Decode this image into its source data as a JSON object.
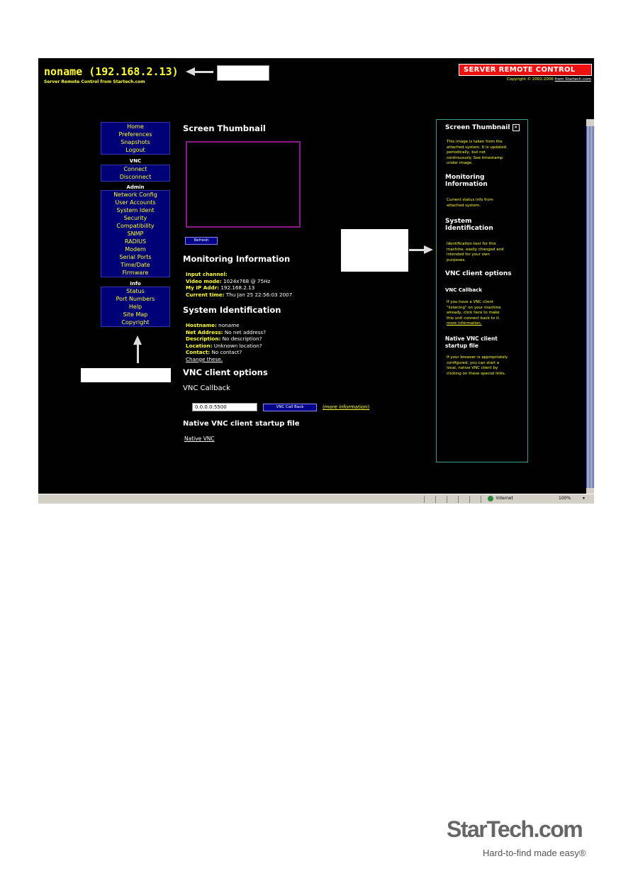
{
  "header": {
    "title": "noname (192.168.2.13)",
    "subtitle": "Server Remote Control from Startech.com",
    "logo": "SERVER REMOTE CONTROL",
    "copyright": "Copyright © 2002-2006",
    "copyright_link": "from Startech.com"
  },
  "nav": {
    "group1": [
      "Home",
      "Preferences",
      "Snapshots",
      "Logout"
    ],
    "vnc_header": "VNC",
    "group2": [
      "Connect",
      "Disconnect"
    ],
    "admin_header": "Admin",
    "group3": [
      "Network Config",
      "User Accounts",
      "System Ident",
      "Security",
      "Compatibility",
      "SNMP",
      "RADIUS",
      "Modem",
      "Serial Ports",
      "Time/Date",
      "Firmware"
    ],
    "info_header": "Info",
    "group4": [
      "Status",
      "Port Numbers",
      "Help",
      "Site Map",
      "Copyright"
    ]
  },
  "main": {
    "thumb_heading": "Screen Thumbnail",
    "refresh_label": "Refresh",
    "monitor_heading": "Monitoring Information",
    "monitor": [
      {
        "label": "Input channel:",
        "value": ""
      },
      {
        "label": "Video mode:",
        "value": "1024x768 @ 75Hz"
      },
      {
        "label": "My IP Addr:",
        "value": "192.168.2.13"
      },
      {
        "label": "Current time:",
        "value": "Thu Jan 25 22:56:03 2007"
      }
    ],
    "sysid_heading": "System Identification",
    "sysid": [
      {
        "label": "Hostname:",
        "value": "noname"
      },
      {
        "label": "Net Address:",
        "value": "No net address?"
      },
      {
        "label": "Description:",
        "value": "No description?"
      },
      {
        "label": "Location:",
        "value": "Unknown location?"
      },
      {
        "label": "Contact:",
        "value": "No contact?"
      }
    ],
    "change_link": "Change these.",
    "vnc_heading": "VNC client options",
    "callback_heading": "VNC Callback",
    "callback_value": "0.0.0.0:5500",
    "callback_button": "VNC Call Back",
    "more_info": "(more information)",
    "native_heading": "Native VNC client startup file",
    "native_link": "Native VNC"
  },
  "sidebar": {
    "thumb_title": "Screen Thumbnail",
    "thumb_text": [
      "This image is taken from the",
      "attached system. It is updated",
      "periodically, but not",
      "continuously. See timestamp",
      "under image."
    ],
    "monitor_title": [
      "Monitoring",
      "Information"
    ],
    "monitor_text": [
      "Current status info from",
      "attached system."
    ],
    "sysid_title": [
      "System",
      "Identification"
    ],
    "sysid_text": [
      "Identification text for this",
      "machine. easily changed and",
      "intended for your own",
      "purposes."
    ],
    "vnc_title": "VNC client options",
    "callback_title": "VNC Callback",
    "callback_text": [
      "If you have a VNC client",
      "\"listening\" on your machine",
      "already, click here to make",
      "this unit connect back to it.",
      "more information."
    ],
    "native_title": [
      "Native VNC client",
      "startup file"
    ],
    "native_text": [
      "If your browser is appropriately",
      "configured, you can start a",
      "local, native VNC client by",
      "clicking on these special links."
    ]
  },
  "statusbar": {
    "zone": "Internet",
    "zoom": "100%"
  },
  "footer": {
    "brand": "StarTech.com",
    "tagline": "Hard-to-find made easy®"
  }
}
